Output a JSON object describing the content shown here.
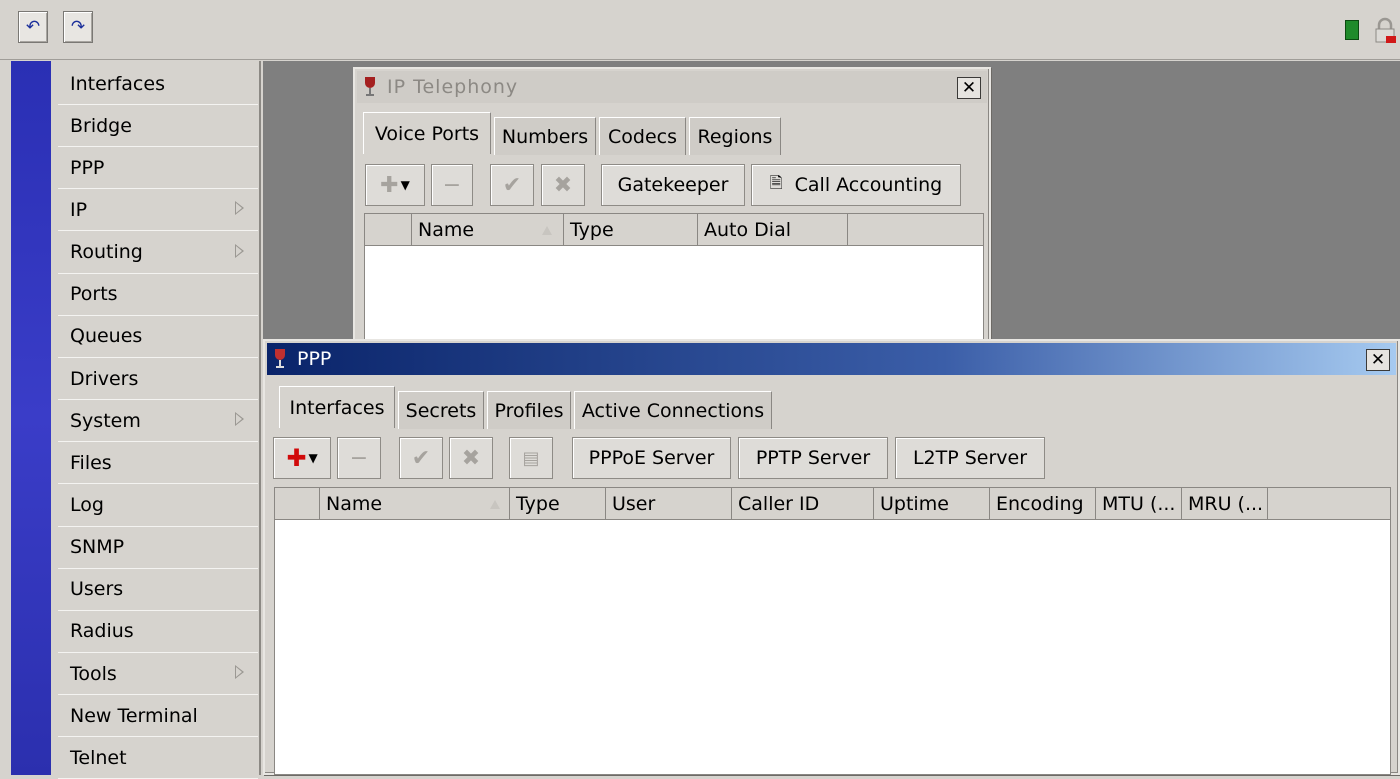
{
  "toolbar": {
    "undo_icon": "undo-icon",
    "redo_icon": "redo-icon",
    "status_color": "#1f8a2a",
    "lock_icon": "lock-icon"
  },
  "sidebar": {
    "accent": "#2a2fb4",
    "items": [
      {
        "label": "Interfaces",
        "submenu": false
      },
      {
        "label": "Bridge",
        "submenu": false
      },
      {
        "label": "PPP",
        "submenu": false
      },
      {
        "label": "IP",
        "submenu": true
      },
      {
        "label": "Routing",
        "submenu": true
      },
      {
        "label": "Ports",
        "submenu": false
      },
      {
        "label": "Queues",
        "submenu": false
      },
      {
        "label": "Drivers",
        "submenu": false
      },
      {
        "label": "System",
        "submenu": true
      },
      {
        "label": "Files",
        "submenu": false
      },
      {
        "label": "Log",
        "submenu": false
      },
      {
        "label": "SNMP",
        "submenu": false
      },
      {
        "label": "Users",
        "submenu": false
      },
      {
        "label": "Radius",
        "submenu": false
      },
      {
        "label": "Tools",
        "submenu": true
      },
      {
        "label": "New Terminal",
        "submenu": false
      },
      {
        "label": "Telnet",
        "submenu": false
      }
    ]
  },
  "telephony": {
    "title": "IP Telephony",
    "tabs": [
      "Voice Ports",
      "Numbers",
      "Codecs",
      "Regions"
    ],
    "buttons": {
      "gatekeeper": "Gatekeeper",
      "call_accounting": "Call Accounting"
    },
    "columns": [
      "Name",
      "Type",
      "Auto Dial"
    ]
  },
  "ppp": {
    "title": "PPP",
    "tabs": [
      "Interfaces",
      "Secrets",
      "Profiles",
      "Active Connections"
    ],
    "buttons": {
      "pppoe": "PPPoE Server",
      "pptp": "PPTP Server",
      "l2tp": "L2TP Server"
    },
    "columns": [
      "Name",
      "Type",
      "User",
      "Caller ID",
      "Uptime",
      "Encoding",
      "MTU (...",
      "MRU (..."
    ],
    "titlebar_gradient": [
      "#0a246a",
      "#a6caf0"
    ]
  }
}
